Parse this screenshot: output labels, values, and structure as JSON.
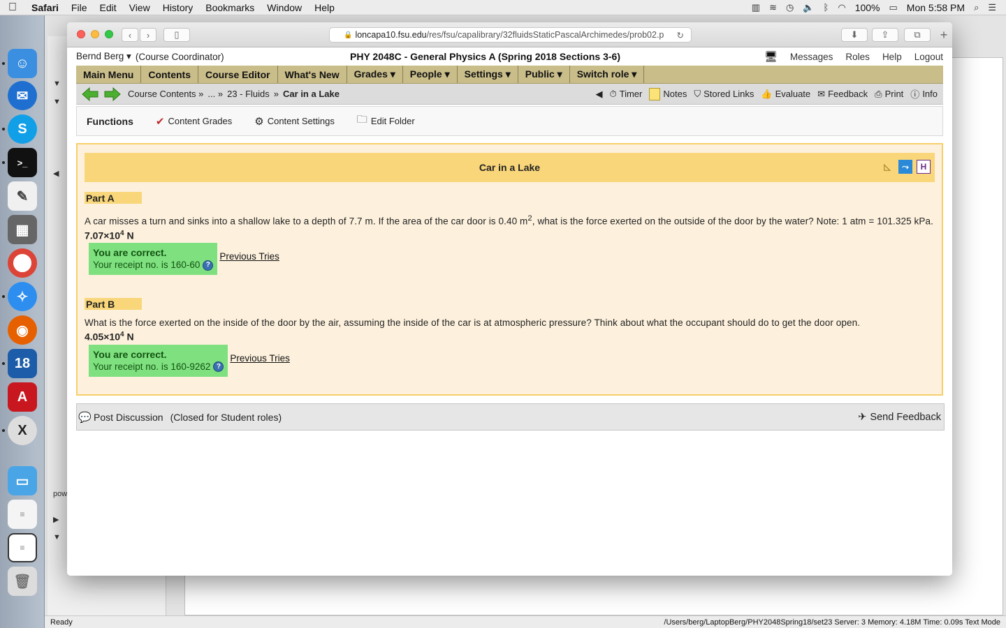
{
  "menubar": {
    "app": "Safari",
    "items": [
      "File",
      "Edit",
      "View",
      "History",
      "Bookmarks",
      "Window",
      "Help"
    ],
    "battery": "100%",
    "clock": "Mon 5:58 PM"
  },
  "safari": {
    "url_domain": "loncapa10.fsu.edu",
    "url_path": "/res/fsu/capalibrary/32fluidsStaticPascalArchimedes/prob02.p"
  },
  "lonCapa": {
    "user": "Bernd Berg ▾",
    "role": "(Course Coordinator)",
    "course": "PHY 2048C - General Physics A (Spring 2018 Sections 3-6)",
    "top_links": [
      "Messages",
      "Roles",
      "Help",
      "Logout"
    ],
    "main_menu": [
      "Main Menu",
      "Contents",
      "Course Editor",
      "What's New",
      "Grades ▾",
      "People ▾",
      "Settings ▾",
      "Public ▾",
      "Switch role ▾"
    ],
    "breadcrumb": {
      "root": "Course Contents »",
      "ellipsis": "... »",
      "folder": "23 - Fluids",
      "sep": "»",
      "current": "Car in a Lake"
    },
    "tools": [
      "Timer",
      "Notes",
      "Stored Links",
      "Evaluate",
      "Feedback",
      "Print",
      "Info"
    ],
    "functions": {
      "title": "Functions",
      "items": [
        "Content Grades",
        "Content Settings",
        "Edit Folder"
      ]
    }
  },
  "problem": {
    "title": "Car in a Lake",
    "partA": {
      "label": "Part A",
      "text_before_sup": "A car misses a turn and sinks into a shallow lake to a depth of 7.7 m. If the area of the car door is 0.40 m",
      "sup": "2",
      "text_after_sup": ", what is the force exerted on the outside of the door by the water? Note: 1 atm = 101.325 kPa.",
      "answer_mantissa": "7.07×10",
      "answer_exp": "4",
      "answer_unit": " N",
      "status": "You are correct.",
      "receipt": "Your receipt no. is 160-60",
      "prev": "Previous Tries"
    },
    "partB": {
      "label": "Part B",
      "text": "What is the force exerted on the inside of the door by the air, assuming the inside of the car is at atmospheric pressure? Think about what the occupant should do to get the door open.",
      "answer_mantissa": "4.05×10",
      "answer_exp": "4",
      "answer_unit": " N",
      "status": "You are correct.",
      "receipt": "Your receipt no. is 160-9262",
      "prev": "Previous Tries"
    }
  },
  "discussion": {
    "post": "Post Discussion",
    "closed": "(Closed for Student roles)",
    "send": "Send Feedback"
  },
  "statusbar": {
    "left": "Ready",
    "right": "/Users/berg/LaptopBerg/PHY2048Spring18/set23   Server: 3   Memory: 4.18M   Time: 0.09s   Text Mode"
  },
  "bg": {
    "pow_label": "pow"
  }
}
